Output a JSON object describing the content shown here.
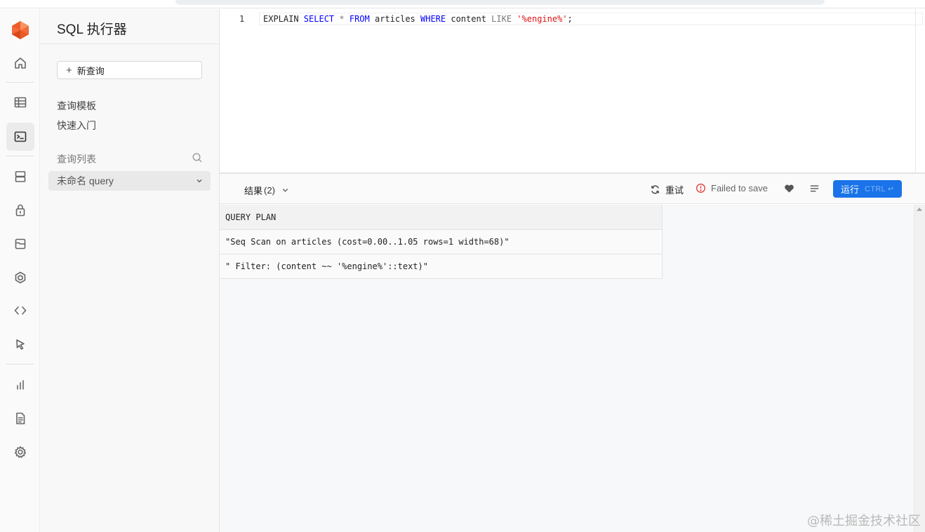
{
  "sidebar": {
    "title": "SQL 执行器",
    "new_query_label": "新查询",
    "links": [
      "查询模板",
      "快速入门"
    ],
    "query_list_label": "查询列表",
    "selected_query": "未命名 query"
  },
  "editor": {
    "line_number": "1",
    "code": {
      "t1": "EXPLAIN ",
      "t2": "SELECT",
      "t3": " * ",
      "t4": "FROM",
      "t5": " articles ",
      "t6": "WHERE",
      "t7": " content ",
      "t8": "LIKE",
      "t9": " ",
      "t10": "'%engine%'",
      "t11": ";"
    }
  },
  "results_toolbar": {
    "tab_label": "结果",
    "tab_count": "(2)",
    "retry_label": "重试",
    "save_status": "Failed to save",
    "run_label": "运行",
    "run_shortcut": "CTRL ↵"
  },
  "results": {
    "column_header": "QUERY PLAN",
    "rows": [
      "\"Seq Scan on articles (cost=0.00..1.05 rows=1 width=68)\"",
      "\" Filter: (content ~~ '%engine%'::text)\""
    ]
  },
  "watermark": "@稀土掘金技术社区",
  "colors": {
    "accent": "#1a73e8",
    "error": "#e53935",
    "logo": "#f26b3a"
  }
}
